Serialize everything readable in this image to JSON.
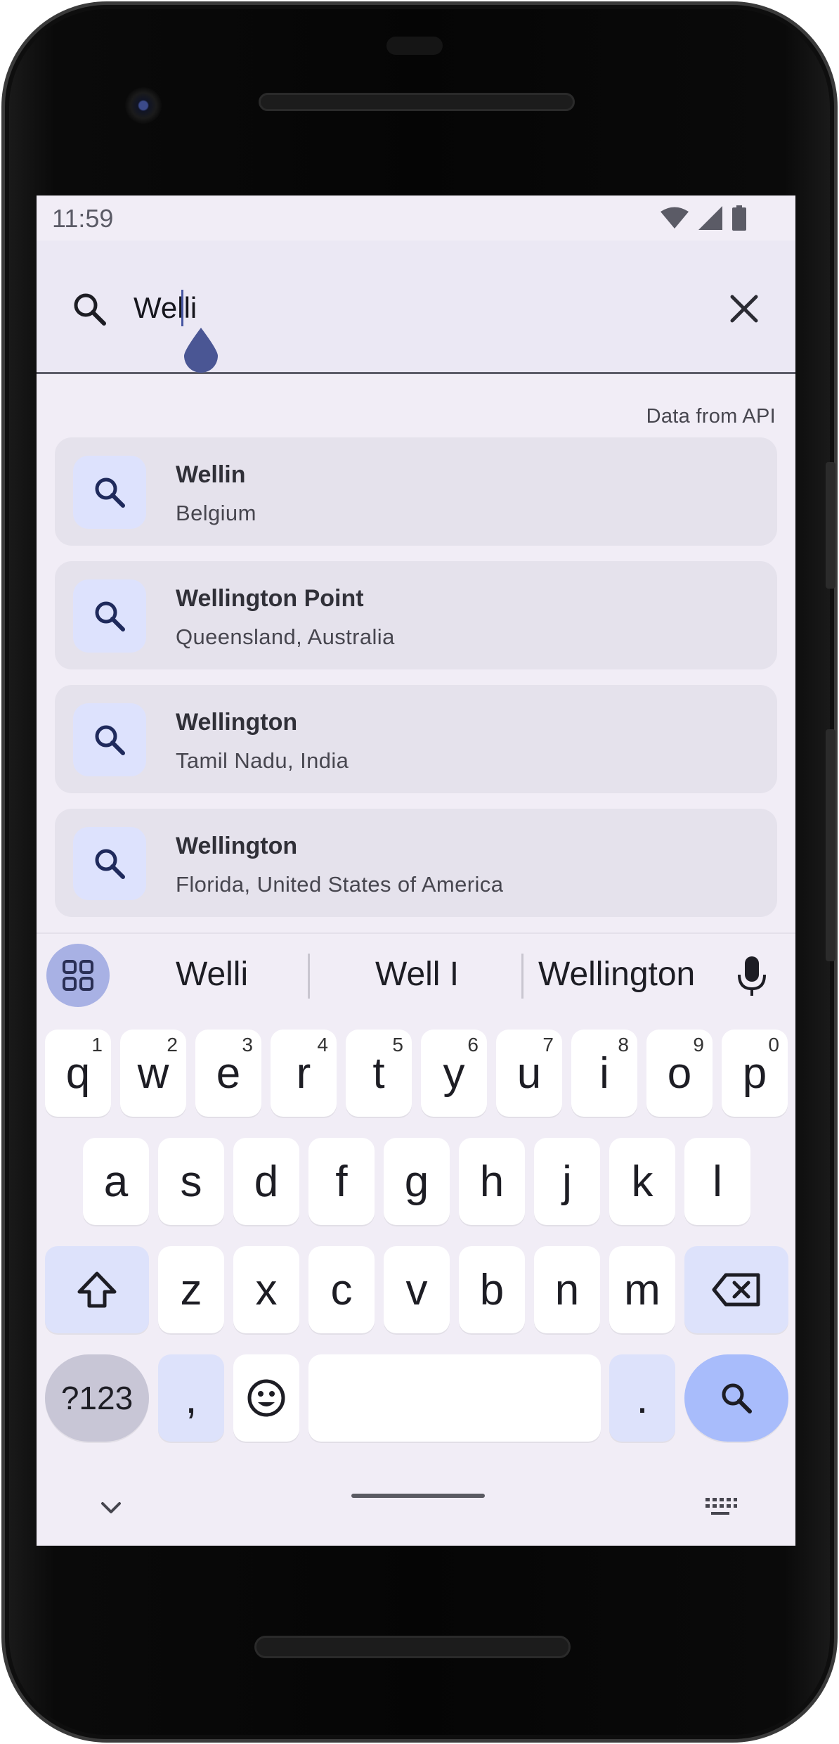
{
  "status_bar": {
    "time": "11:59",
    "icons": [
      "wifi-icon",
      "signal-icon",
      "battery-icon"
    ]
  },
  "search": {
    "query": "Welli",
    "icon": "search-icon",
    "clear_icon": "close-icon"
  },
  "results": {
    "source_label": "Data from API",
    "items": [
      {
        "title": "Wellin",
        "subtitle": "Belgium"
      },
      {
        "title": "Wellington Point",
        "subtitle": "Queensland, Australia"
      },
      {
        "title": "Wellington",
        "subtitle": "Tamil Nadu, India"
      },
      {
        "title": "Wellington",
        "subtitle": "Florida, United States of America"
      }
    ]
  },
  "keyboard": {
    "suggestions": [
      "Welli",
      "Well I",
      "Wellington"
    ],
    "row1": [
      {
        "k": "q",
        "h": "1"
      },
      {
        "k": "w",
        "h": "2"
      },
      {
        "k": "e",
        "h": "3"
      },
      {
        "k": "r",
        "h": "4"
      },
      {
        "k": "t",
        "h": "5"
      },
      {
        "k": "y",
        "h": "6"
      },
      {
        "k": "u",
        "h": "7"
      },
      {
        "k": "i",
        "h": "8"
      },
      {
        "k": "o",
        "h": "9"
      },
      {
        "k": "p",
        "h": "0"
      }
    ],
    "row2": [
      "a",
      "s",
      "d",
      "f",
      "g",
      "h",
      "j",
      "k",
      "l"
    ],
    "row3": [
      "z",
      "x",
      "c",
      "v",
      "b",
      "n",
      "m"
    ],
    "symbols_label": "?123",
    "comma": ",",
    "period": ".",
    "colors": {
      "accent": "#a8bcfb",
      "modifier": "#dde2fb",
      "symbol_key": "#c8c6d6",
      "caret": "#4756a2"
    }
  }
}
